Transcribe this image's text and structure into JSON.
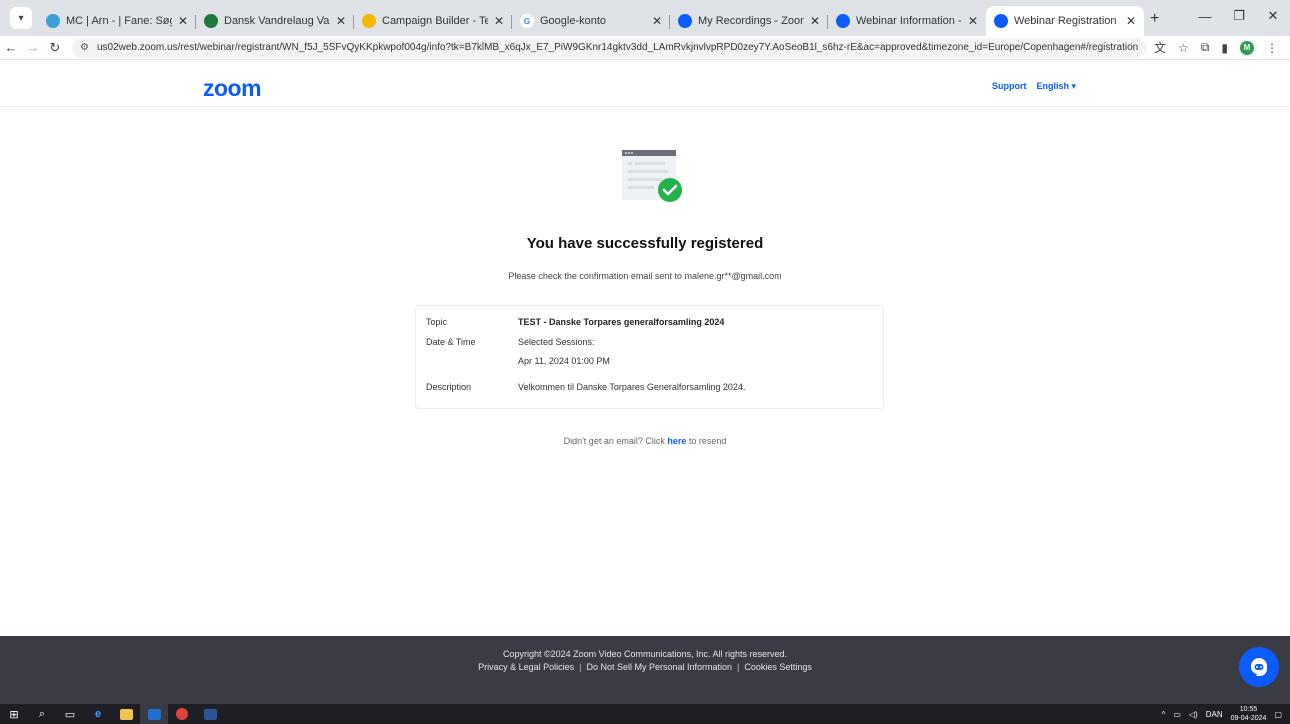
{
  "browser": {
    "tabs": [
      {
        "title": "MC | Arn - | Fane: Søg",
        "favicon_color": "#3aa0d8",
        "active": false
      },
      {
        "title": "Dansk Vandrelaug Vandretur: L",
        "favicon_color": "#1e7a3a",
        "active": false
      },
      {
        "title": "Campaign Builder - Template D",
        "favicon_color": "#f5b800",
        "active": false
      },
      {
        "title": "Google-konto",
        "favicon_color": "#4285f4",
        "active": false
      },
      {
        "title": "My Recordings - Zoom",
        "favicon_color": "#0b5cff",
        "active": false
      },
      {
        "title": "Webinar Information - Zoom",
        "favicon_color": "#0b5cff",
        "active": false
      },
      {
        "title": "Webinar Registration - Zoom",
        "favicon_color": "#0b5cff",
        "active": true
      }
    ],
    "new_tab": "+",
    "url": "us02web.zoom.us/rest/webinar/registrant/WN_f5J_5SFvQyKKpkwpof004g/info?tk=B7klMB_x6qJx_E7_PiW9GKnr14gktv3dd_LAmRvkjnvlvpRPD0zey7Y.AoSeoB1l_s6hz-rE&ac=approved&timezone_id=Europe/Copenhagen#/registration",
    "profile_initial": "M"
  },
  "header": {
    "logo": "zoom",
    "support": "Support",
    "language": "English ▾"
  },
  "main": {
    "title": "You have successfully registered",
    "confirmation": "Please check the confirmation email sent to malene.gr**@gmail.com",
    "details": {
      "topic_label": "Topic",
      "topic_value": "TEST - Danske Torpares generalforsamling 2024",
      "datetime_label": "Date & Time",
      "sessions_label": "Selected Sessions:",
      "session_value": "Apr 11, 2024 01:00 PM",
      "description_label": "Description",
      "description_value": "Velkommen til Danske Torpares Generalforsamling 2024."
    },
    "resend_prefix": "Didn't get an email? Click",
    "resend_link": "here",
    "resend_suffix": "to resend"
  },
  "footer": {
    "copyright": "Copyright ©2024 Zoom Video Communications, Inc. All rights reserved.",
    "links": [
      "Privacy & Legal Policies",
      "Do Not Sell My Personal Information",
      "Cookies Settings"
    ]
  },
  "taskbar": {
    "language": "DAN",
    "time": "10:55",
    "date": "09-04-2024"
  },
  "colors": {
    "zoom_blue": "#0b5cff",
    "success_green": "#22b14c",
    "footer_bg": "#3b3b46"
  }
}
